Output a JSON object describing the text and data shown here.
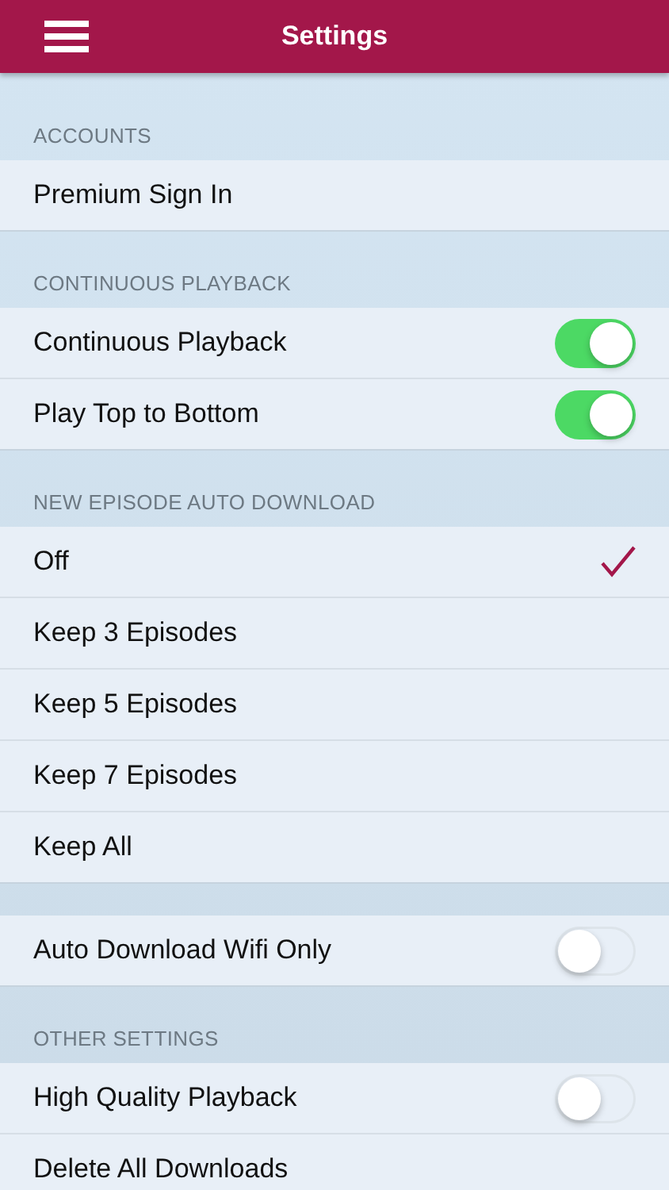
{
  "header": {
    "title": "Settings"
  },
  "sections": [
    {
      "title": "ACCOUNTS",
      "items": [
        {
          "kind": "link",
          "label": "Premium Sign In"
        }
      ]
    },
    {
      "title": "CONTINUOUS PLAYBACK",
      "items": [
        {
          "kind": "toggle",
          "label": "Continuous Playback",
          "on": true
        },
        {
          "kind": "toggle",
          "label": "Play Top to Bottom",
          "on": true
        }
      ]
    },
    {
      "title": "NEW EPISODE AUTO DOWNLOAD",
      "items": [
        {
          "kind": "choice",
          "label": "Off",
          "selected": true
        },
        {
          "kind": "choice",
          "label": "Keep 3 Episodes",
          "selected": false
        },
        {
          "kind": "choice",
          "label": "Keep 5 Episodes",
          "selected": false
        },
        {
          "kind": "choice",
          "label": "Keep 7 Episodes",
          "selected": false
        },
        {
          "kind": "choice",
          "label": "Keep All",
          "selected": false
        }
      ]
    },
    {
      "items": [
        {
          "kind": "toggle",
          "label": "Auto Download Wifi Only",
          "on": false
        }
      ]
    },
    {
      "title": "OTHER SETTINGS",
      "items": [
        {
          "kind": "toggle",
          "label": "High Quality Playback",
          "on": false
        },
        {
          "kind": "link",
          "label": "Delete All Downloads"
        }
      ]
    }
  ]
}
